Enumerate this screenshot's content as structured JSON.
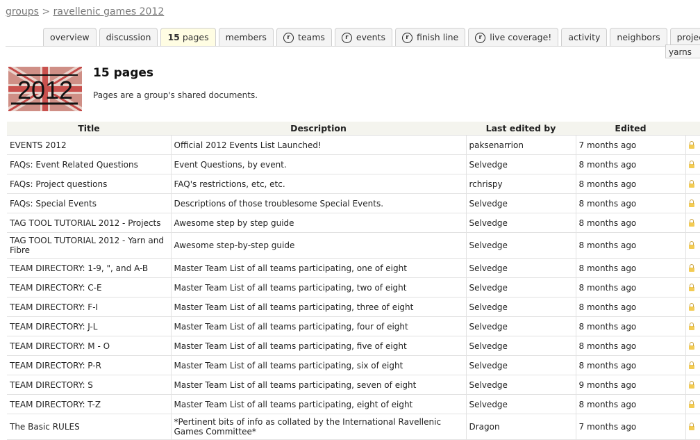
{
  "breadcrumb": {
    "root": "groups",
    "sep": ">",
    "current": "ravellenic games 2012"
  },
  "tabs": [
    {
      "label": "overview",
      "count": "",
      "icon": false,
      "active": false
    },
    {
      "label": "discussion",
      "count": "",
      "icon": false,
      "active": false
    },
    {
      "label": "pages",
      "count": "15",
      "icon": false,
      "active": true
    },
    {
      "label": "members",
      "count": "",
      "icon": false,
      "active": false
    },
    {
      "label": "teams",
      "count": "",
      "icon": true,
      "active": false
    },
    {
      "label": "events",
      "count": "",
      "icon": true,
      "active": false
    },
    {
      "label": "finish line",
      "count": "",
      "icon": true,
      "active": false
    },
    {
      "label": "live coverage!",
      "count": "",
      "icon": true,
      "active": false
    },
    {
      "label": "activity",
      "count": "",
      "icon": false,
      "active": false
    },
    {
      "label": "neighbors",
      "count": "",
      "icon": false,
      "active": false
    },
    {
      "label": "projects",
      "count": "",
      "icon": false,
      "active": false
    }
  ],
  "tab_icon_glyph": "r",
  "tooltip": "yarns",
  "logo": {
    "text": "2012"
  },
  "page": {
    "title": "15 pages",
    "subtitle": "Pages are a group's shared documents."
  },
  "table": {
    "headers": [
      "Title",
      "Description",
      "Last edited by",
      "Edited"
    ],
    "rows": [
      {
        "title": "EVENTS 2012",
        "description": "Official 2012 Events List Launched!",
        "editor": "paksenarrion",
        "edited": "7 months ago"
      },
      {
        "title": "FAQs: Event Related Questions",
        "description": "Event Questions, by event.",
        "editor": "Selvedge",
        "edited": "8 months ago"
      },
      {
        "title": "FAQs: Project questions",
        "description": "FAQ's restrictions, etc, etc.",
        "editor": "rchrispy",
        "edited": "8 months ago"
      },
      {
        "title": "FAQs: Special Events",
        "description": "Descriptions of those troublesome Special Events.",
        "editor": "Selvedge",
        "edited": "8 months ago"
      },
      {
        "title": "TAG TOOL TUTORIAL 2012 - Projects",
        "description": "Awesome step by step guide",
        "editor": "Selvedge",
        "edited": "8 months ago"
      },
      {
        "title": "TAG TOOL TUTORIAL 2012 - Yarn and Fibre",
        "description": "Awesome step-by-step guide",
        "editor": "Selvedge",
        "edited": "8 months ago"
      },
      {
        "title": "TEAM DIRECTORY: 1-9, \", and A-B",
        "description": "Master Team List of all teams participating, one of eight",
        "editor": "Selvedge",
        "edited": "8 months ago"
      },
      {
        "title": "TEAM DIRECTORY: C-E",
        "description": "Master Team List of all teams participating, two of eight",
        "editor": "Selvedge",
        "edited": "8 months ago"
      },
      {
        "title": "TEAM DIRECTORY: F-I",
        "description": "Master Team List of all teams participating, three of eight",
        "editor": "Selvedge",
        "edited": "8 months ago"
      },
      {
        "title": "TEAM DIRECTORY: J-L",
        "description": "Master Team List of all teams participating, four of eight",
        "editor": "Selvedge",
        "edited": "8 months ago"
      },
      {
        "title": "TEAM DIRECTORY: M - O",
        "description": "Master Team List of all teams participating, five of eight",
        "editor": "Selvedge",
        "edited": "8 months ago"
      },
      {
        "title": "TEAM DIRECTORY: P-R",
        "description": "Master Team List of all teams participating, six of eight",
        "editor": "Selvedge",
        "edited": "8 months ago"
      },
      {
        "title": "TEAM DIRECTORY: S",
        "description": "Master Team List of all teams participating, seven of eight",
        "editor": "Selvedge",
        "edited": "9 months ago"
      },
      {
        "title": "TEAM DIRECTORY: T-Z",
        "description": "Master Team List of all teams participating, eight of eight",
        "editor": "Selvedge",
        "edited": "8 months ago"
      },
      {
        "title": "The Basic RULES",
        "description": "*Pertinent bits of info as collated by the International Ravellenic Games Committee*",
        "editor": "Dragon",
        "edited": "7 months ago"
      }
    ]
  }
}
